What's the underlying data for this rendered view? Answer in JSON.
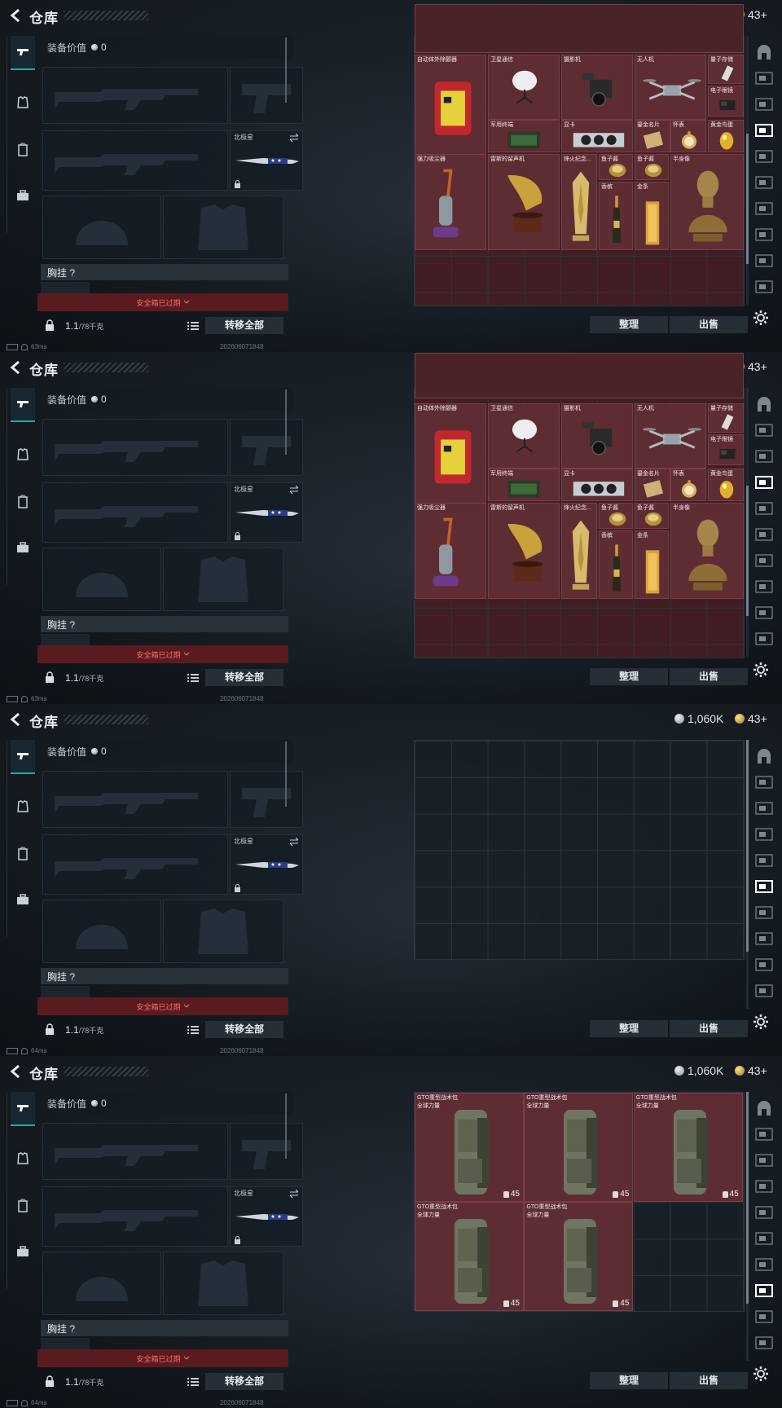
{
  "header": {
    "title": "仓库",
    "silver": "1,060K",
    "gold": "43+"
  },
  "loadout": {
    "equip_value_label": "装备价值",
    "equip_value": "0",
    "knife_label": "北极星",
    "rig_label": "胸挂 ?",
    "safebox_text": "安全箱已过期",
    "weight": "1.1",
    "weight_cap": "/78千克",
    "transfer_label": "转移全部"
  },
  "actions": {
    "organize": "整理",
    "sell": "出售"
  },
  "status": {
    "ping1": "63ms",
    "ping2": "63ms",
    "ping3": "64ms",
    "ping4": "64ms",
    "stamp": "202606071848"
  },
  "valuables": [
    {
      "name": "自动体外除颤器",
      "icon": "defibrillator-icon"
    },
    {
      "name": "卫星通信",
      "icon": "satellite-dish-icon"
    },
    {
      "name": "摄影机",
      "icon": "camera-icon"
    },
    {
      "name": "无人机",
      "icon": "drone-icon"
    },
    {
      "name": "量子存储",
      "icon": "quantum-storage-icon"
    },
    {
      "name": "电子眼镜",
      "icon": "smart-glasses-icon"
    },
    {
      "name": "军用终端",
      "icon": "military-terminal-icon"
    },
    {
      "name": "显卡",
      "icon": "graphics-card-icon"
    },
    {
      "name": "鎏金名片",
      "icon": "gilded-card-icon"
    },
    {
      "name": "怀表",
      "icon": "pocket-watch-icon"
    },
    {
      "name": "黄金鸟蛋",
      "icon": "golden-egg-icon"
    },
    {
      "name": "强力吸尘器",
      "icon": "vacuum-icon"
    },
    {
      "name": "雷斯的留声机",
      "icon": "gramophone-icon"
    },
    {
      "name": "烽火纪念...",
      "icon": "trophy-icon"
    },
    {
      "name": "鱼子酱",
      "icon": "caviar-icon"
    },
    {
      "name": "鱼子酱",
      "icon": "caviar-icon"
    },
    {
      "name": "香槟",
      "icon": "champagne-icon"
    },
    {
      "name": "金条",
      "icon": "gold-bar-icon"
    },
    {
      "name": "半身像",
      "icon": "bust-icon"
    }
  ],
  "backpacks": [
    {
      "name": "GTO重型战术包",
      "sub": "全球力量",
      "count": "45"
    },
    {
      "name": "GTO重型战术包",
      "sub": "全球力量",
      "count": "45"
    },
    {
      "name": "GTO重型战术包",
      "sub": "全球力量",
      "count": "45"
    },
    {
      "name": "GTO重型战术包",
      "sub": "全球力量",
      "count": "45"
    },
    {
      "name": "GTO重型战术包",
      "sub": "全球力量",
      "count": "45"
    }
  ]
}
